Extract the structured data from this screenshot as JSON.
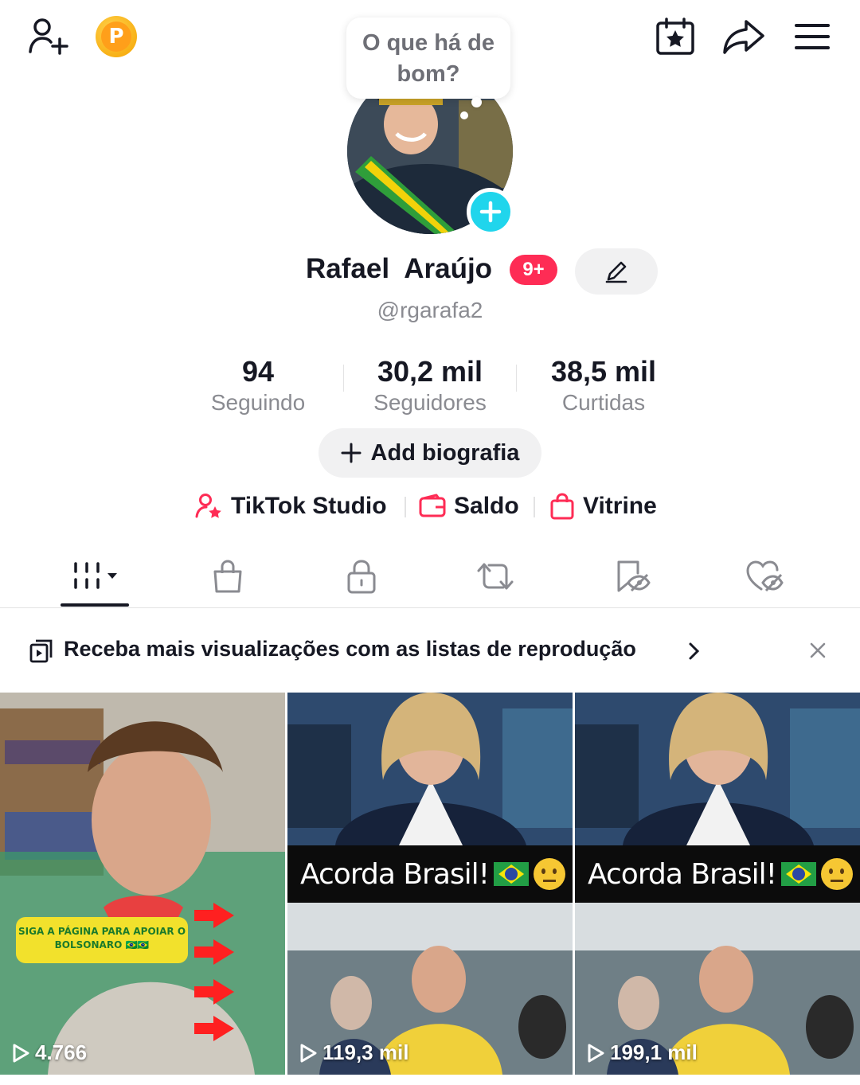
{
  "header": {
    "bubble_text": "O que há de bom?",
    "coin_letter": "P",
    "icons": [
      "add-friend-icon",
      "coin-icon",
      "calendar-star-icon",
      "share-icon",
      "menu-icon"
    ]
  },
  "profile": {
    "name": "Rafael  Araújo",
    "notification_badge": "9+",
    "handle": "@rgarafa2"
  },
  "stats": [
    {
      "value": "94",
      "label": "Seguindo"
    },
    {
      "value": "30,2 mil",
      "label": "Seguidores"
    },
    {
      "value": "38,5 mil",
      "label": "Curtidas"
    }
  ],
  "bio_button": "Add biografia",
  "links": [
    {
      "label": "TikTok Studio",
      "icon": "studio-icon"
    },
    {
      "label": "Saldo",
      "icon": "wallet-icon"
    },
    {
      "label": "Vitrine",
      "icon": "shopping-bag-icon"
    }
  ],
  "tabs": [
    "videos-grid-icon",
    "shop-icon",
    "lock-icon",
    "repost-icon",
    "saved-hidden-icon",
    "liked-hidden-icon"
  ],
  "promo": {
    "text": "Receba mais visualizações com as listas de reprodução"
  },
  "videos": [
    {
      "views": "4.766",
      "overlay_text": "SIGA A PÁGINA PARA APOIAR O BOLSONARO 🇧🇷🇧🇷"
    },
    {
      "views": "119,3 mil",
      "caption": "Acorda Brasil!"
    },
    {
      "views": "199,1 mil",
      "caption": "Acorda Brasil!"
    }
  ],
  "colors": {
    "accent_red": "#fe2c55",
    "plus_cyan": "#20d5ec",
    "text_primary": "#161823",
    "text_secondary": "#8a8b91"
  }
}
